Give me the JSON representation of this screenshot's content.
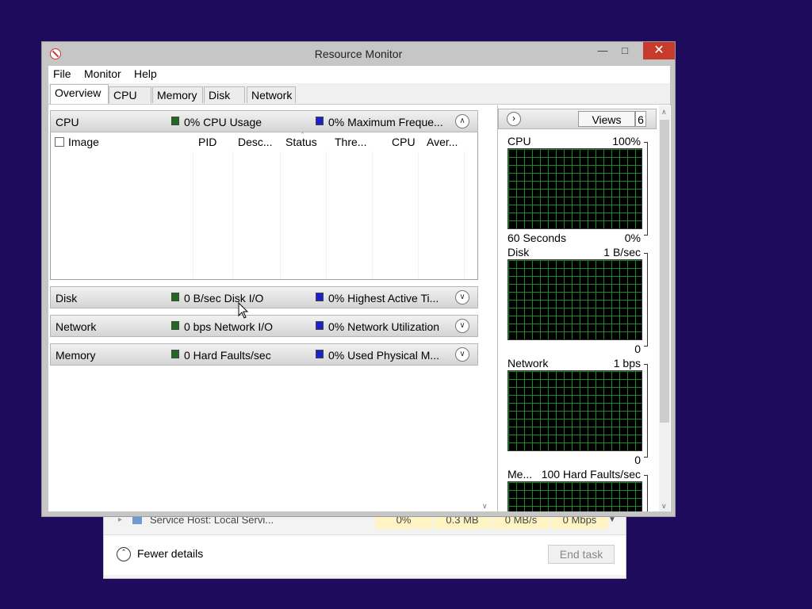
{
  "window": {
    "title": "Resource Monitor",
    "minimize": "—",
    "maximize": "□",
    "close": "✕"
  },
  "menu": [
    "File",
    "Monitor",
    "Help"
  ],
  "tabs": [
    "Overview",
    "CPU",
    "Memory",
    "Disk",
    "Network"
  ],
  "active_tab": "Overview",
  "sections": {
    "cpu": {
      "title": "CPU",
      "stat1": "0% CPU Usage",
      "stat2": "0% Maximum Freque...",
      "expanded": true,
      "columns": [
        "Image",
        "PID",
        "Desc...",
        "Status",
        "Thre...",
        "CPU",
        "Aver..."
      ]
    },
    "disk": {
      "title": "Disk",
      "stat1": "0 B/sec Disk I/O",
      "stat2": "0% Highest Active Ti..."
    },
    "network": {
      "title": "Network",
      "stat1": "0 bps Network I/O",
      "stat2": "0% Network Utilization"
    },
    "memory": {
      "title": "Memory",
      "stat1": "0 Hard Faults/sec",
      "stat2": "0% Used Physical M..."
    }
  },
  "views": {
    "label": "Views",
    "count": "6"
  },
  "graphs": {
    "cpu": {
      "name": "CPU",
      "max": "100%",
      "bottom_left": "60 Seconds",
      "min": "0%"
    },
    "disk": {
      "name": "Disk",
      "max": "1 B/sec",
      "min": "0"
    },
    "network": {
      "name": "Network",
      "max": "1 bps",
      "min": "0"
    },
    "memory": {
      "name": "Me...",
      "max": "100 Hard Faults/sec"
    }
  },
  "colors": {
    "green": "#1f6b22",
    "blue": "#1a22c8",
    "close_red": "#c73b2d",
    "desktop": "#1e0b5c"
  },
  "taskmgr": {
    "row": [
      "Service Host: Local Servi...",
      "0%",
      "0.3 MB",
      "0 MB/s",
      "0 Mbps"
    ],
    "fewer_details": "Fewer details",
    "end_task": "End task"
  }
}
